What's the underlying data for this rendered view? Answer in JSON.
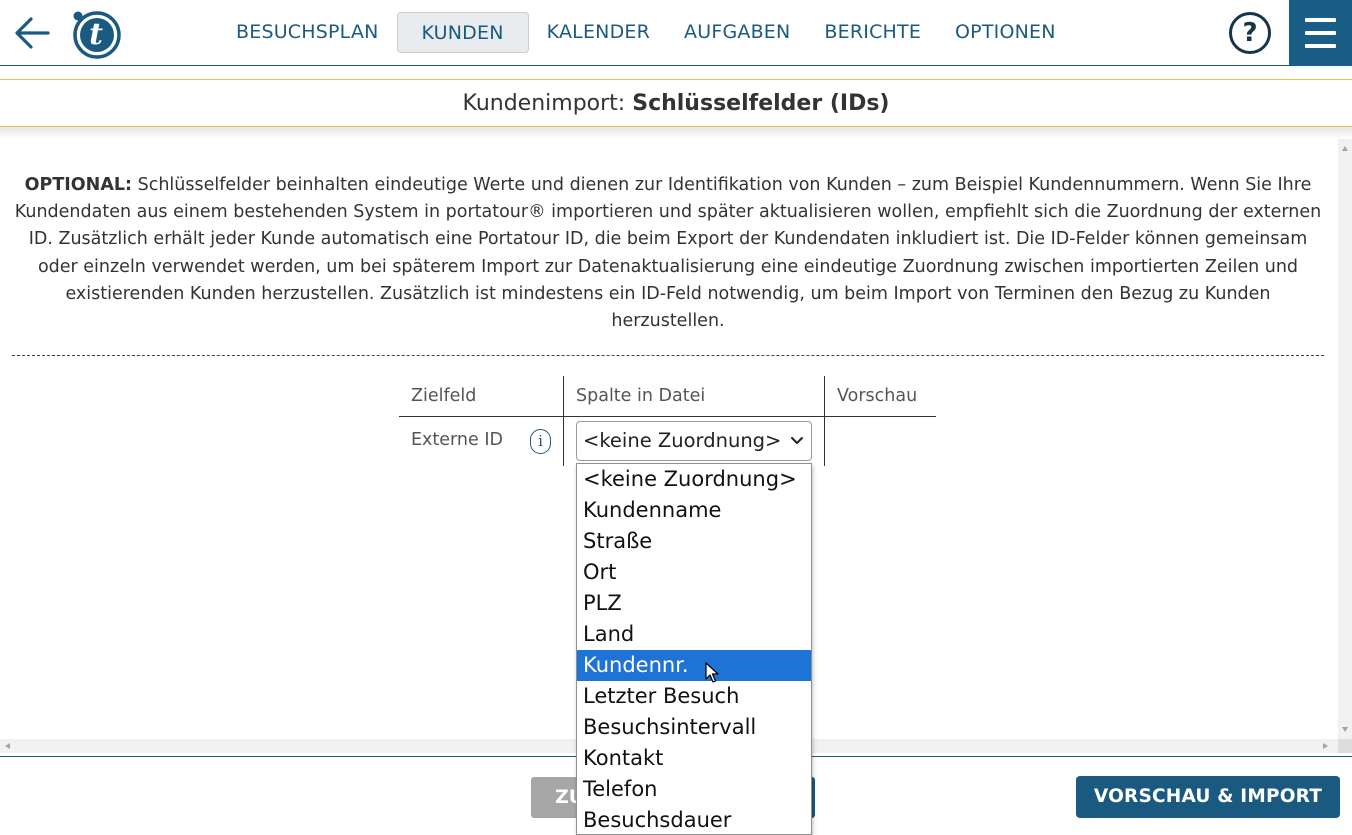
{
  "nav": {
    "items": [
      "BESUCHSPLAN",
      "KUNDEN",
      "KALENDER",
      "AUFGABEN",
      "BERICHTE",
      "OPTIONEN"
    ],
    "active": "KUNDEN",
    "help_label": "?"
  },
  "logo_text": "t",
  "title": {
    "prefix": "Kundenimport: ",
    "bold": "Schlüsselfelder (IDs)"
  },
  "intro": {
    "lead": "OPTIONAL:",
    "text": " Schlüsselfelder beinhalten eindeutige Werte und dienen zur Identifikation von Kunden – zum Beispiel Kundennummern. Wenn Sie Ihre Kundendaten aus einem bestehenden System in portatour® importieren und später aktualisieren wollen, empfiehlt sich die Zuordnung der externen ID. Zusätzlich erhält jeder Kunde automatisch eine Portatour ID, die beim Export der Kundendaten inkludiert ist. Die ID-Felder können gemeinsam oder einzeln verwendet werden, um bei späterem Import zur Datenaktualisierung eine eindeutige Zuordnung zwischen importierten Zeilen und existierenden Kunden herzustellen. Zusätzlich ist mindestens ein ID-Feld notwendig, um beim Import von Terminen den Bezug zu Kunden herzustellen."
  },
  "table": {
    "headers": [
      "Zielfeld",
      "Spalte in Datei",
      "Vorschau"
    ],
    "row": {
      "label": "Externe ID",
      "info": "i",
      "selected": "<keine Zuordnung>",
      "preview": ""
    }
  },
  "dropdown": {
    "options": [
      "<keine Zuordnung>",
      "Kundenname",
      "Straße",
      "Ort",
      "PLZ",
      "Land",
      "Kundennr.",
      "Letzter Besuch",
      "Besuchsintervall",
      "Kontakt",
      "Telefon",
      "Besuchsdauer"
    ],
    "highlighted": "Kundennr."
  },
  "footer": {
    "back_label": "ZU",
    "import_label": "VORSCHAU & IMPORT"
  },
  "colors": {
    "brand": "#1b5a80",
    "accent_line": "#e8c44a",
    "highlight": "#1e74d6"
  },
  "icons": [
    "back-arrow-icon",
    "logo-icon",
    "help-icon",
    "hamburger-menu-icon",
    "info-icon",
    "chevron-down-icon",
    "mouse-cursor-icon"
  ]
}
